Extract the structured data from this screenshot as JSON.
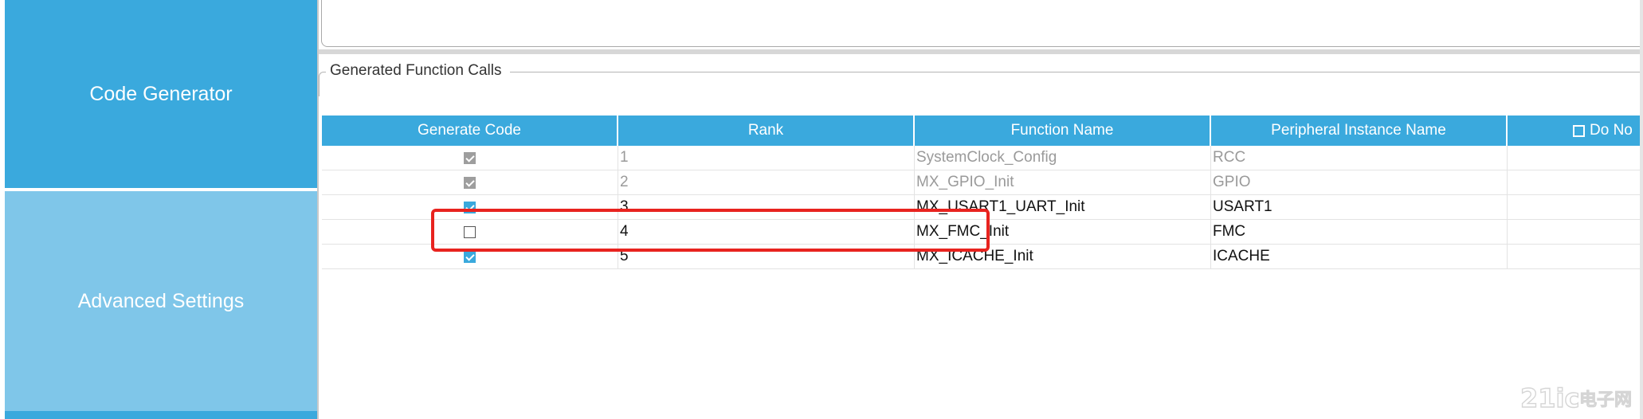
{
  "sidebar": {
    "code_generator": "Code Generator",
    "advanced_settings": "Advanced Settings"
  },
  "group": {
    "title": "Generated Function Calls"
  },
  "table": {
    "columns": [
      "Generate Code",
      "Rank",
      "Function Name",
      "Peripheral Instance Name",
      "Do No"
    ],
    "rows": [
      {
        "generate": true,
        "enabled": false,
        "rank": "1",
        "function": "SystemClock_Config",
        "peripheral": "RCC"
      },
      {
        "generate": true,
        "enabled": false,
        "rank": "2",
        "function": "MX_GPIO_Init",
        "peripheral": "GPIO"
      },
      {
        "generate": true,
        "enabled": true,
        "rank": "3",
        "function": "MX_USART1_UART_Init",
        "peripheral": "USART1"
      },
      {
        "generate": false,
        "enabled": true,
        "rank": "4",
        "function": "MX_FMC_Init",
        "peripheral": "FMC"
      },
      {
        "generate": true,
        "enabled": true,
        "rank": "5",
        "function": "MX_ICACHE_Init",
        "peripheral": "ICACHE"
      }
    ]
  },
  "watermark": {
    "text": "21ic电子网"
  },
  "colors": {
    "accent": "#3aa9dd",
    "sidebar_inactive": "#7fc6e9",
    "highlight": "#e8231f"
  }
}
